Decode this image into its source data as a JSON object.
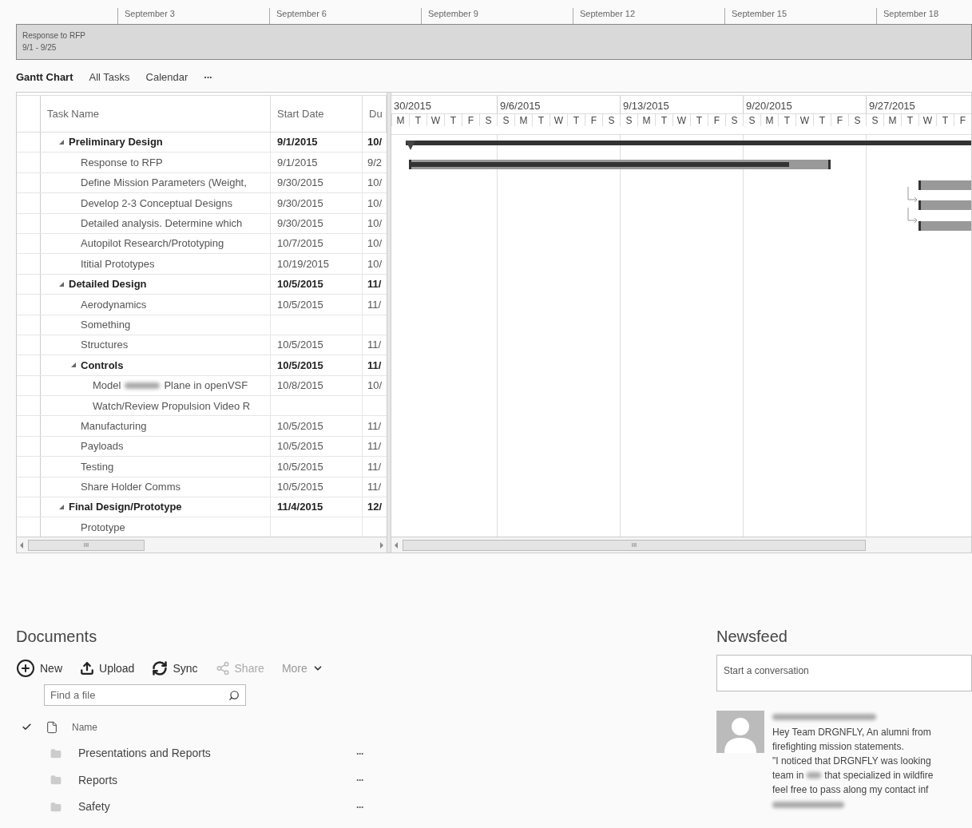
{
  "timeline": {
    "dates": [
      "September 3",
      "September 6",
      "September 9",
      "September 12",
      "September 15",
      "September 18"
    ],
    "bar": {
      "title": "Response to RFP",
      "range": "9/1 - 9/25"
    }
  },
  "views": [
    {
      "label": "Gantt Chart",
      "selected": true
    },
    {
      "label": "All Tasks",
      "selected": false
    },
    {
      "label": "Calendar",
      "selected": false
    }
  ],
  "views_more": "···",
  "gantt": {
    "columns": [
      "Task Name",
      "Start Date",
      "Du"
    ],
    "weeks": [
      {
        "label": "30/2015",
        "days": [
          "M",
          "T",
          "W",
          "T",
          "F",
          "S"
        ]
      },
      {
        "label": "9/6/2015",
        "days": [
          "S",
          "M",
          "T",
          "W",
          "T",
          "F",
          "S"
        ]
      },
      {
        "label": "9/13/2015",
        "days": [
          "S",
          "M",
          "T",
          "W",
          "T",
          "F",
          "S"
        ]
      },
      {
        "label": "9/20/2015",
        "days": [
          "S",
          "M",
          "T",
          "W",
          "T",
          "F",
          "S"
        ]
      },
      {
        "label": "9/27/2015",
        "days": [
          "S",
          "M",
          "T",
          "W",
          "T",
          "F"
        ]
      }
    ],
    "tasks": [
      {
        "name": "Preliminary Design",
        "start": "9/1/2015",
        "duration": "10/",
        "expanded": true,
        "bar": {
          "kind": "summary"
        },
        "children": [
          {
            "name": "Response to RFP",
            "start": "9/1/2015",
            "duration": "9/2",
            "bar": {
              "kind": "task",
              "ends_in_view": true,
              "level": 0.9
            }
          },
          {
            "name": "Define Mission Parameters (Weight,",
            "start": "9/30/2015",
            "duration": "10/",
            "bar": {
              "kind": "task",
              "linked": false
            }
          },
          {
            "name": "Develop 2-3 Conceptual Designs",
            "start": "9/30/2015",
            "duration": "10/",
            "bar": {
              "kind": "task",
              "linked": true
            }
          },
          {
            "name": "Detailed analysis. Determine which",
            "start": "9/30/2015",
            "duration": "10/",
            "bar": {
              "kind": "task",
              "linked": true
            }
          },
          {
            "name": "Autopilot Research/Prototyping",
            "start": "10/7/2015",
            "duration": "10/"
          },
          {
            "name": "Ititial Prototypes",
            "start": "10/19/2015",
            "duration": "10/"
          }
        ]
      },
      {
        "name": "Detailed Design",
        "start": "10/5/2015",
        "duration": "11/",
        "expanded": true,
        "children": [
          {
            "name": "Aerodynamics",
            "start": "10/5/2015",
            "duration": "11/"
          },
          {
            "name": "Something"
          },
          {
            "name": "Structures",
            "start": "10/5/2015",
            "duration": "11/"
          },
          {
            "name": "Controls",
            "start": "10/5/2015",
            "duration": "11/",
            "expanded": true,
            "children": [
              {
                "name": "Model",
                "name_rest": "Plane in openVSF",
                "start": "10/8/2015",
                "duration": "10/"
              },
              {
                "name": "Watch/Review Propulsion Video R"
              }
            ]
          },
          {
            "name": "Manufacturing",
            "start": "10/5/2015",
            "duration": "11/"
          },
          {
            "name": "Payloads",
            "start": "10/5/2015",
            "duration": "11/"
          },
          {
            "name": "Testing",
            "start": "10/5/2015",
            "duration": "11/"
          },
          {
            "name": "Share Holder Comms",
            "start": "10/5/2015",
            "duration": "11/"
          }
        ]
      },
      {
        "name": "Final Design/Prototype",
        "start": "11/4/2015",
        "duration": "12/",
        "expanded": true,
        "children": [
          {
            "name": "Prototype"
          }
        ]
      }
    ],
    "scroll_grips": [
      "III",
      "III"
    ]
  },
  "documents": {
    "title": "Documents",
    "actions": [
      {
        "kind": "new",
        "label": "New",
        "disabled": false
      },
      {
        "kind": "upload",
        "label": "Upload",
        "disabled": false
      },
      {
        "kind": "sync",
        "label": "Sync",
        "disabled": false
      },
      {
        "kind": "share",
        "label": "Share",
        "disabled": true
      },
      {
        "kind": "more",
        "label": "More",
        "disabled": false
      }
    ],
    "search": {
      "placeholder": "Find a file"
    },
    "header": "Name",
    "items": [
      {
        "name": "Presentations and Reports",
        "menu": "···"
      },
      {
        "name": "Reports",
        "menu": "···"
      },
      {
        "name": "Safety",
        "menu": "···"
      }
    ]
  },
  "newsfeed": {
    "title": "Newsfeed",
    "input": {
      "placeholder": "Start a conversation"
    },
    "post": {
      "lines": [
        {
          "text": "Hey Team DRGNFLY, An alumni from"
        },
        {
          "text": "firefighting mission statements."
        },
        {
          "text": "\"I noticed that DRGNFLY was looking"
        },
        {
          "text": "team in",
          "text_rest": "that specialized in wildfire"
        },
        {
          "text": "feel free to pass along my contact inf"
        }
      ]
    }
  }
}
